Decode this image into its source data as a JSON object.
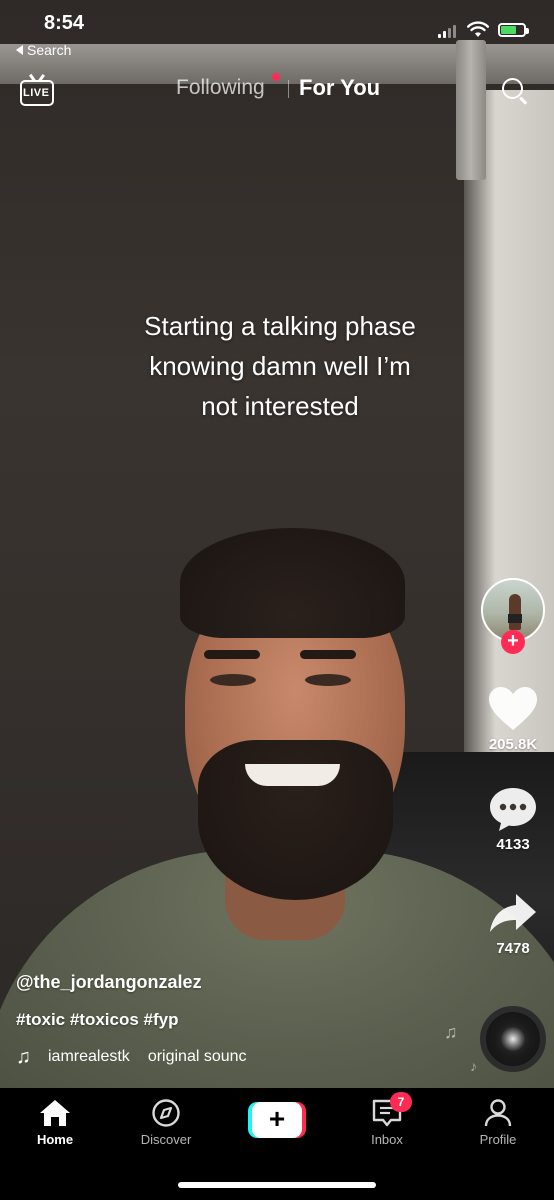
{
  "status_bar": {
    "time": "8:54",
    "back_label": "Search",
    "battery_color": "#4cd964"
  },
  "top_nav": {
    "live_label": "LIVE",
    "tabs": [
      {
        "label": "Following",
        "active": false,
        "has_dot": true
      },
      {
        "label": "For You",
        "active": true
      }
    ],
    "search_icon": "search-icon"
  },
  "video": {
    "caption_lines": [
      "Starting a talking phase",
      "knowing damn well I’m",
      "not interested"
    ]
  },
  "right_rail": {
    "likes": "205.8K",
    "comments": "4133",
    "shares": "7478",
    "follow_icon": "plus-icon",
    "like_icon": "heart-icon",
    "comment_icon": "comment-icon",
    "share_icon": "share-arrow-icon"
  },
  "post": {
    "username": "@the_jordangonzalez",
    "hashtags": "#toxic #toxicos #fyp",
    "sound_artist": "iamrealestk",
    "sound_title": "original sounc"
  },
  "tab_bar": {
    "items": [
      {
        "label": "Home",
        "icon": "home-icon",
        "active": true
      },
      {
        "label": "Discover",
        "icon": "compass-icon",
        "active": false
      },
      {
        "label": "",
        "icon": "plus-icon",
        "active": false
      },
      {
        "label": "Inbox",
        "icon": "inbox-icon",
        "active": false,
        "badge": "7"
      },
      {
        "label": "Profile",
        "icon": "person-icon",
        "active": false
      }
    ]
  },
  "colors": {
    "accent_red": "#fe2c55",
    "accent_cyan": "#25f4ee"
  }
}
